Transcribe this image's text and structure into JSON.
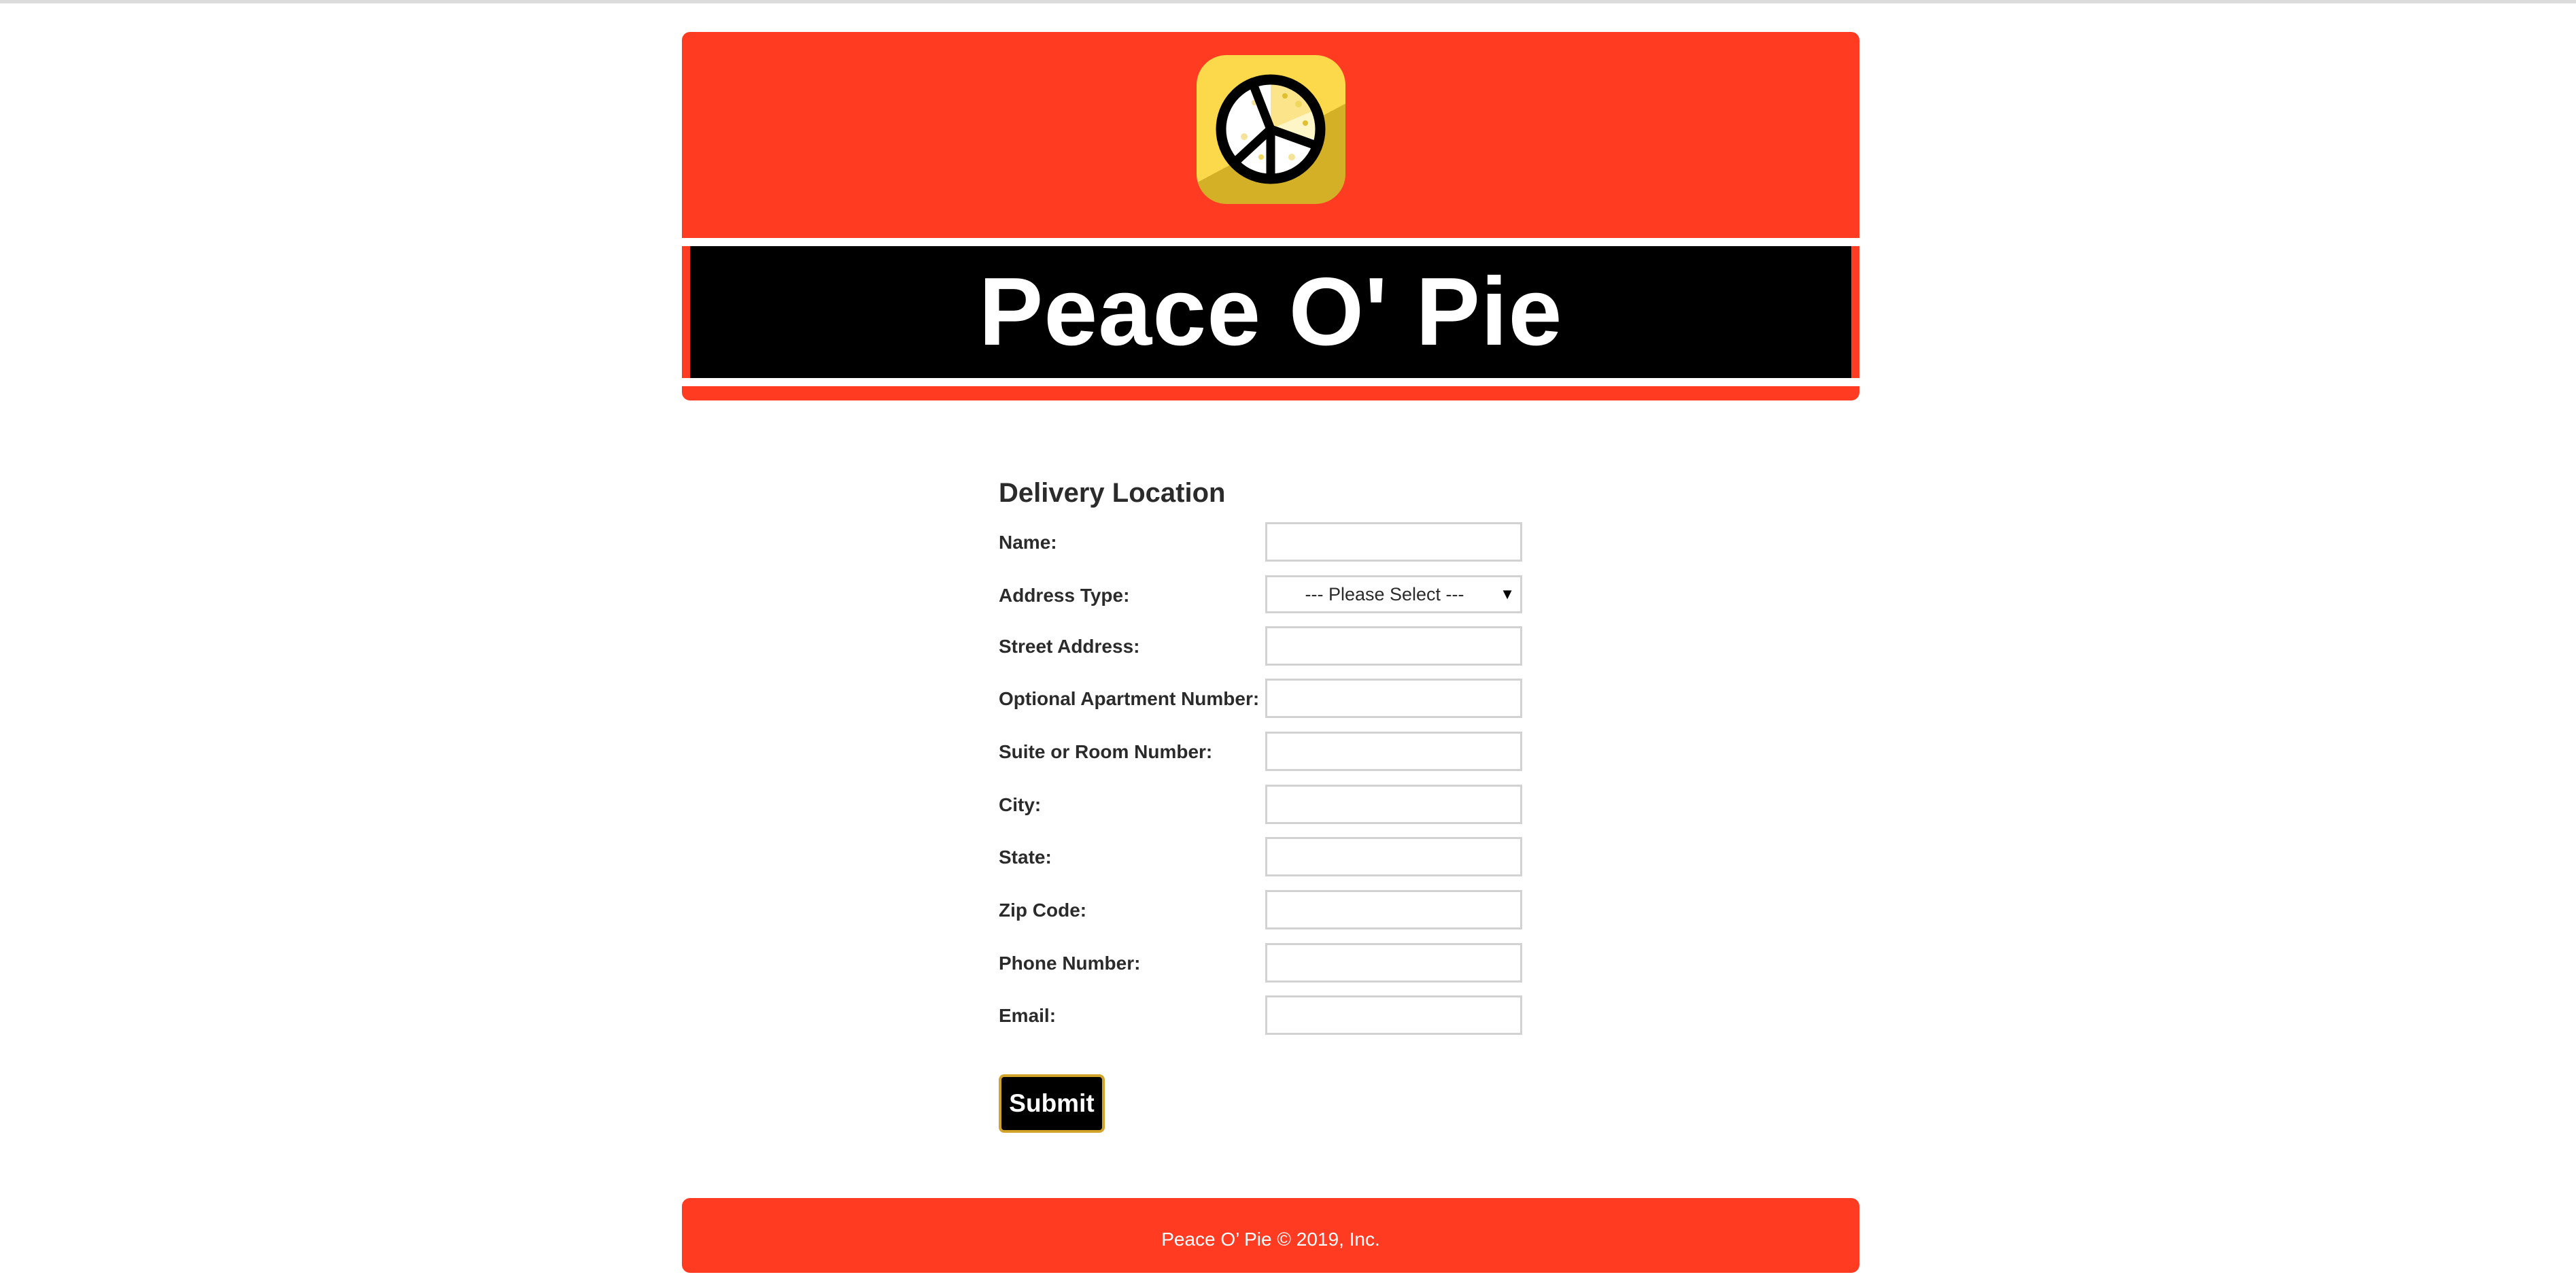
{
  "site": {
    "title": "Peace O' Pie",
    "logo_icon": "peace-pizza-logo-icon"
  },
  "form": {
    "heading": "Delivery Location",
    "fields": [
      {
        "label": "Name:",
        "value": ""
      },
      {
        "label": "Address Type:",
        "selected": "--- Please Select ---"
      },
      {
        "label": "Street Address:",
        "value": ""
      },
      {
        "label": "Optional Apartment Number:",
        "value": ""
      },
      {
        "label": "Suite or Room Number:",
        "value": ""
      },
      {
        "label": "City:",
        "value": ""
      },
      {
        "label": "State:",
        "value": ""
      },
      {
        "label": "Zip Code:",
        "value": ""
      },
      {
        "label": "Phone Number:",
        "value": ""
      },
      {
        "label": "Email:",
        "value": ""
      }
    ],
    "submit_label": "Submit"
  },
  "footer": {
    "text": "Peace O’ Pie © 2019, Inc."
  },
  "colors": {
    "header_red": "#ff3b22",
    "title_band": "#000000",
    "logo_yellow": "#fbd94a",
    "logo_gold": "#d3b026",
    "submit_border": "#d2a52a"
  }
}
